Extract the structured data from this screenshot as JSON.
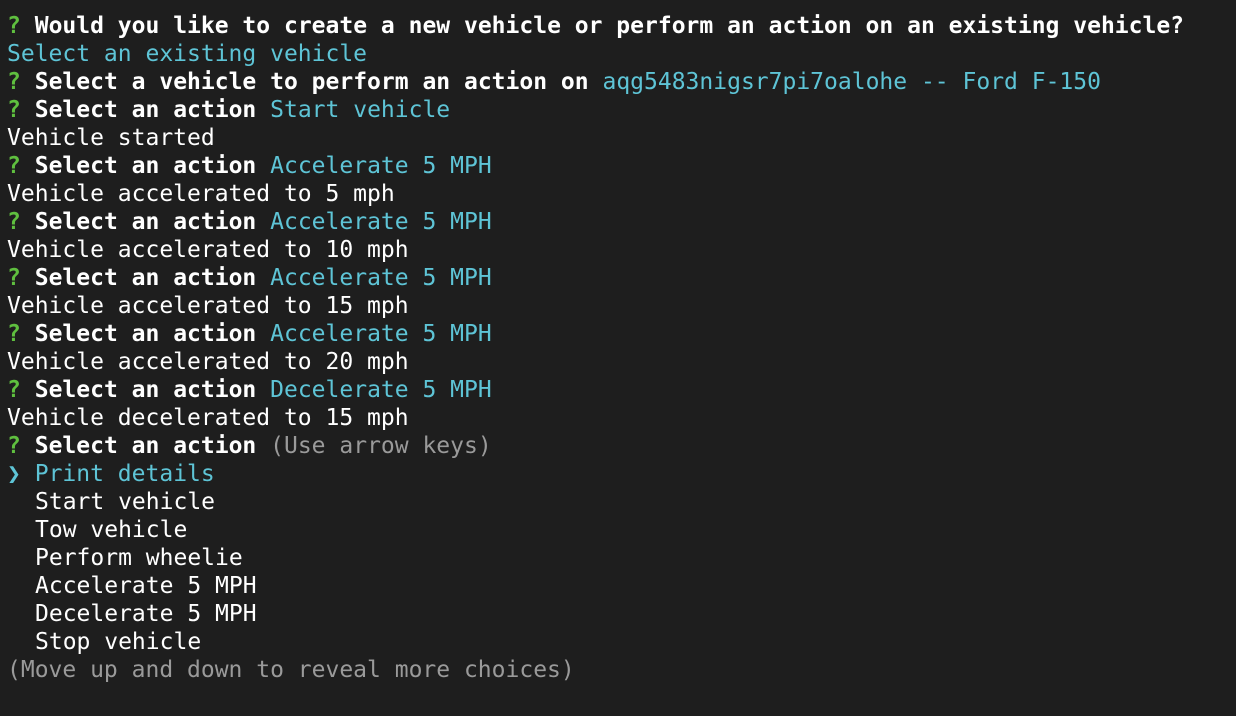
{
  "colors": {
    "background": "#1e1e1e",
    "prompt_mark": "#5fbf3f",
    "answer": "#5ec4d6",
    "hint": "#9a9a9a",
    "text": "#ffffff"
  },
  "session": {
    "q1": {
      "mark": "?",
      "question": "Would you like to create a new vehicle or perform an action on an existing vehicle?",
      "answer": "Select an existing vehicle"
    },
    "q2": {
      "mark": "?",
      "question": "Select a vehicle to perform an action on",
      "answer": "aqg5483nigsr7pi7oalohe -- Ford F-150"
    },
    "actions": [
      {
        "mark": "?",
        "question": "Select an action",
        "answer": "Start vehicle",
        "result": "Vehicle started"
      },
      {
        "mark": "?",
        "question": "Select an action",
        "answer": "Accelerate 5 MPH",
        "result": "Vehicle accelerated to 5 mph"
      },
      {
        "mark": "?",
        "question": "Select an action",
        "answer": "Accelerate 5 MPH",
        "result": "Vehicle accelerated to 10 mph"
      },
      {
        "mark": "?",
        "question": "Select an action",
        "answer": "Accelerate 5 MPH",
        "result": "Vehicle accelerated to 15 mph"
      },
      {
        "mark": "?",
        "question": "Select an action",
        "answer": "Accelerate 5 MPH",
        "result": "Vehicle accelerated to 20 mph"
      },
      {
        "mark": "?",
        "question": "Select an action",
        "answer": "Decelerate 5 MPH",
        "result": "Vehicle decelerated to 15 mph"
      }
    ],
    "current": {
      "mark": "?",
      "question": "Select an action",
      "hint": "(Use arrow keys)",
      "pointer": "❯",
      "choices": [
        "Print details",
        "Start vehicle",
        "Tow vehicle",
        "Perform wheelie",
        "Accelerate 5 MPH",
        "Decelerate 5 MPH",
        "Stop vehicle"
      ],
      "footer_hint": "(Move up and down to reveal more choices)"
    }
  }
}
